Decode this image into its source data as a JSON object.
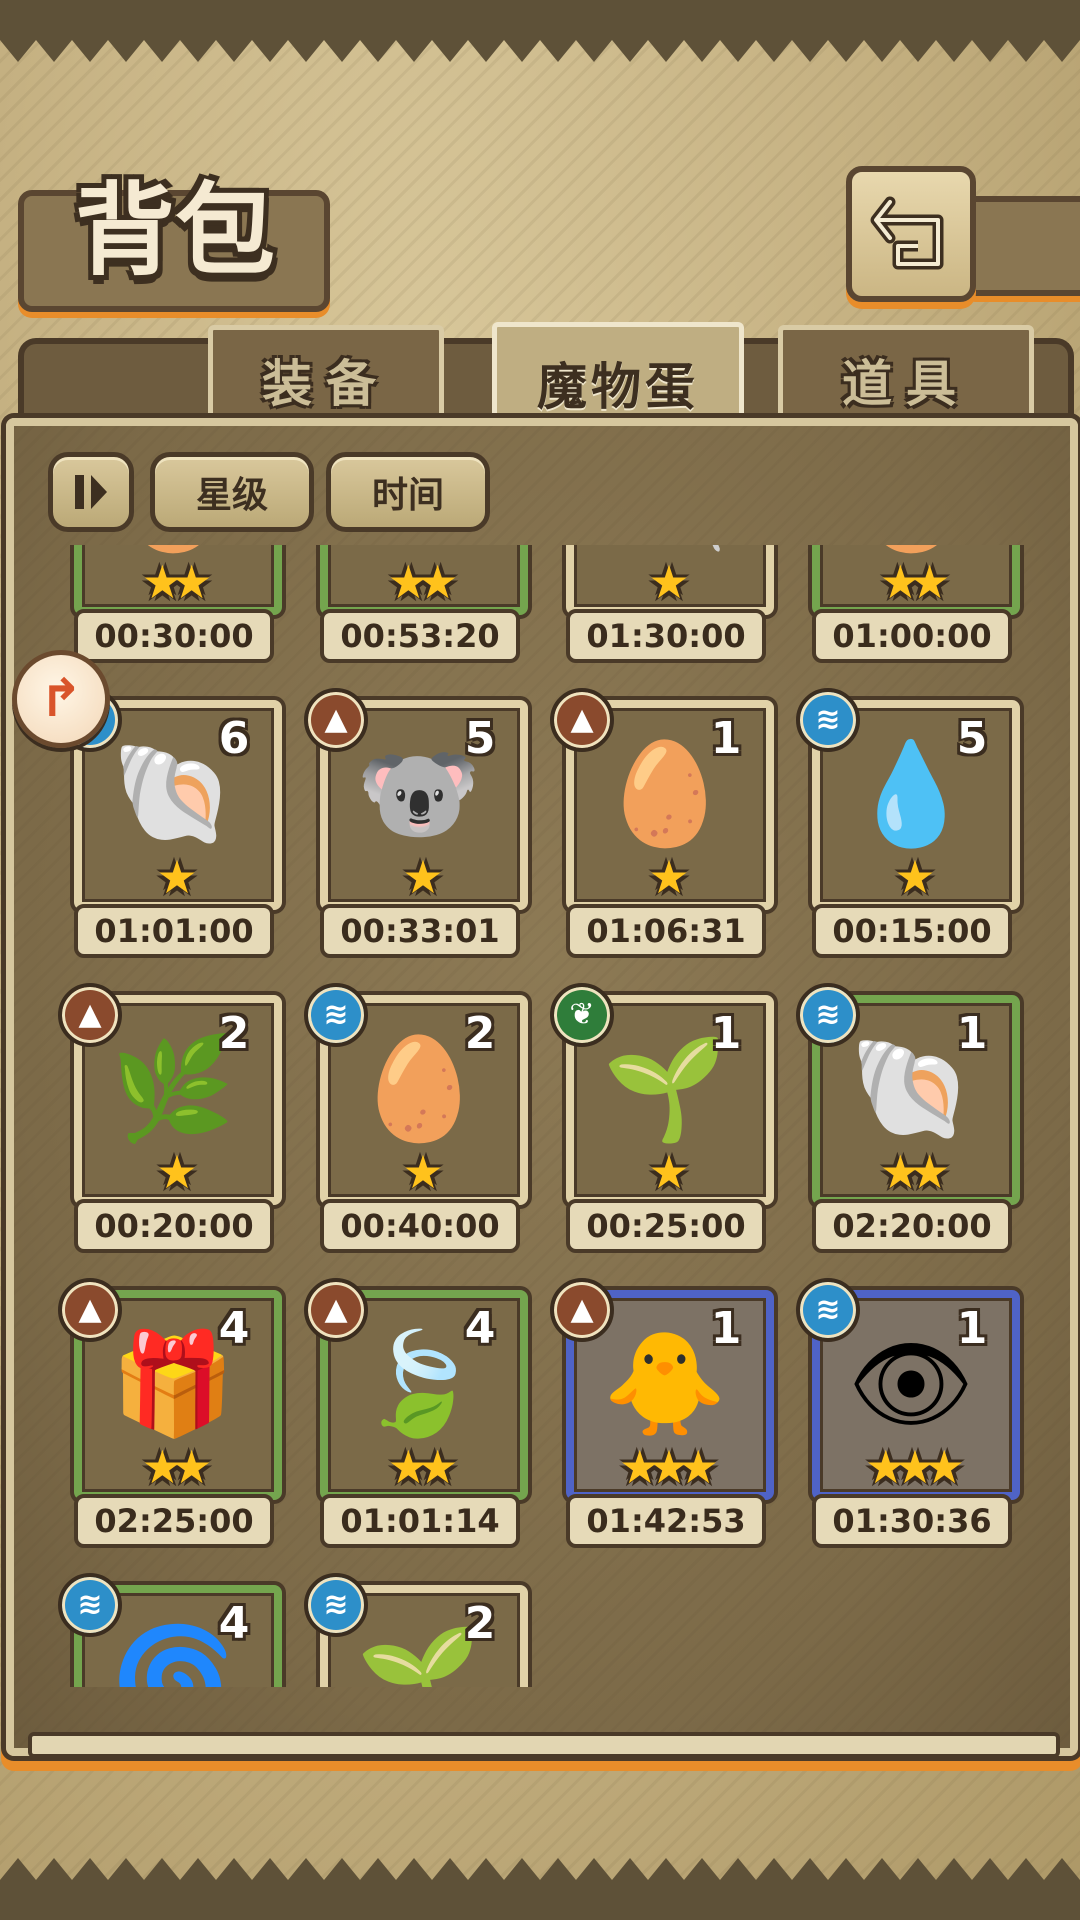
{
  "header": {
    "title": "背包",
    "back_icon": "back-arrow-icon"
  },
  "tabs": [
    {
      "label": "装备",
      "active": false
    },
    {
      "label": "魔物蛋",
      "active": true
    },
    {
      "label": "道具",
      "active": false
    }
  ],
  "sort_bar": {
    "toggle_icon": "sort-toggle-icon",
    "star_label": "星级",
    "time_label": "时间"
  },
  "eggs": [
    {
      "creature_icon": "orange-egg-icon",
      "stars": "★★",
      "timer": "00:30:00",
      "rarity": 2
    },
    {
      "creature_icon": "gray-bat-egg-icon",
      "stars": "★★",
      "timer": "00:53:20",
      "rarity": 2
    },
    {
      "creature_icon": "blue-feather-egg-icon",
      "stars": "★",
      "timer": "01:30:00",
      "rarity": 1
    },
    {
      "creature_icon": "white-egg-icon",
      "stars": "★★",
      "timer": "01:00:00",
      "rarity": 2
    },
    {
      "element": "water",
      "creature_icon": "blue-shell-egg-icon",
      "count": "6",
      "stars": "★",
      "timer": "01:01:00",
      "rarity": 1
    },
    {
      "element": "earth",
      "creature_icon": "koala-egg-icon",
      "count": "5",
      "stars": "★",
      "timer": "00:33:01",
      "rarity": 1
    },
    {
      "element": "earth",
      "creature_icon": "zebra-tail-egg-icon",
      "count": "1",
      "stars": "★",
      "timer": "01:06:31",
      "rarity": 1
    },
    {
      "element": "water",
      "creature_icon": "slime-egg-icon",
      "count": "5",
      "stars": "★",
      "timer": "00:15:00",
      "rarity": 1
    },
    {
      "element": "earth",
      "creature_icon": "leaf-bud-egg-icon",
      "count": "2",
      "stars": "★",
      "timer": "00:20:00",
      "rarity": 1
    },
    {
      "element": "water",
      "creature_icon": "zebra-tail-egg-icon",
      "count": "2",
      "stars": "★",
      "timer": "00:40:00",
      "rarity": 1
    },
    {
      "element": "wood",
      "creature_icon": "sprout-bulb-egg-icon",
      "count": "1",
      "stars": "★",
      "timer": "00:25:00",
      "rarity": 1
    },
    {
      "element": "water",
      "creature_icon": "dark-shell-egg-icon",
      "count": "1",
      "stars": "★★",
      "timer": "02:20:00",
      "rarity": 2
    },
    {
      "element": "earth",
      "creature_icon": "wrapped-ball-egg-icon",
      "count": "4",
      "stars": "★★",
      "timer": "02:25:00",
      "rarity": 2
    },
    {
      "element": "earth",
      "creature_icon": "leaf-shell-egg-icon",
      "count": "4",
      "stars": "★★",
      "timer": "01:01:14",
      "rarity": 2
    },
    {
      "element": "earth",
      "creature_icon": "fluffy-chick-egg-icon",
      "count": "1",
      "stars": "★★★",
      "timer": "01:42:53",
      "rarity": 3
    },
    {
      "element": "water",
      "creature_icon": "blue-eye-egg-icon",
      "count": "1",
      "stars": "★★★",
      "timer": "01:30:36",
      "rarity": 3
    },
    {
      "element": "water",
      "creature_icon": "spiral-shell-egg-icon",
      "count": "4",
      "rarity": 2
    },
    {
      "element": "water",
      "creature_icon": "sprout-bulb-egg-icon",
      "count": "2",
      "rarity": 1
    }
  ],
  "element_icons": {
    "earth": "mountain-icon",
    "water": "wave-icon",
    "wood": "leaf-icon"
  },
  "float_button_icon": "curved-arrow-icon",
  "colors": {
    "accent_orange": "#e88d2a",
    "rarity_green": "#74a54e",
    "rarity_blue": "#4f63c7",
    "star_gold": "#ffc21c"
  }
}
